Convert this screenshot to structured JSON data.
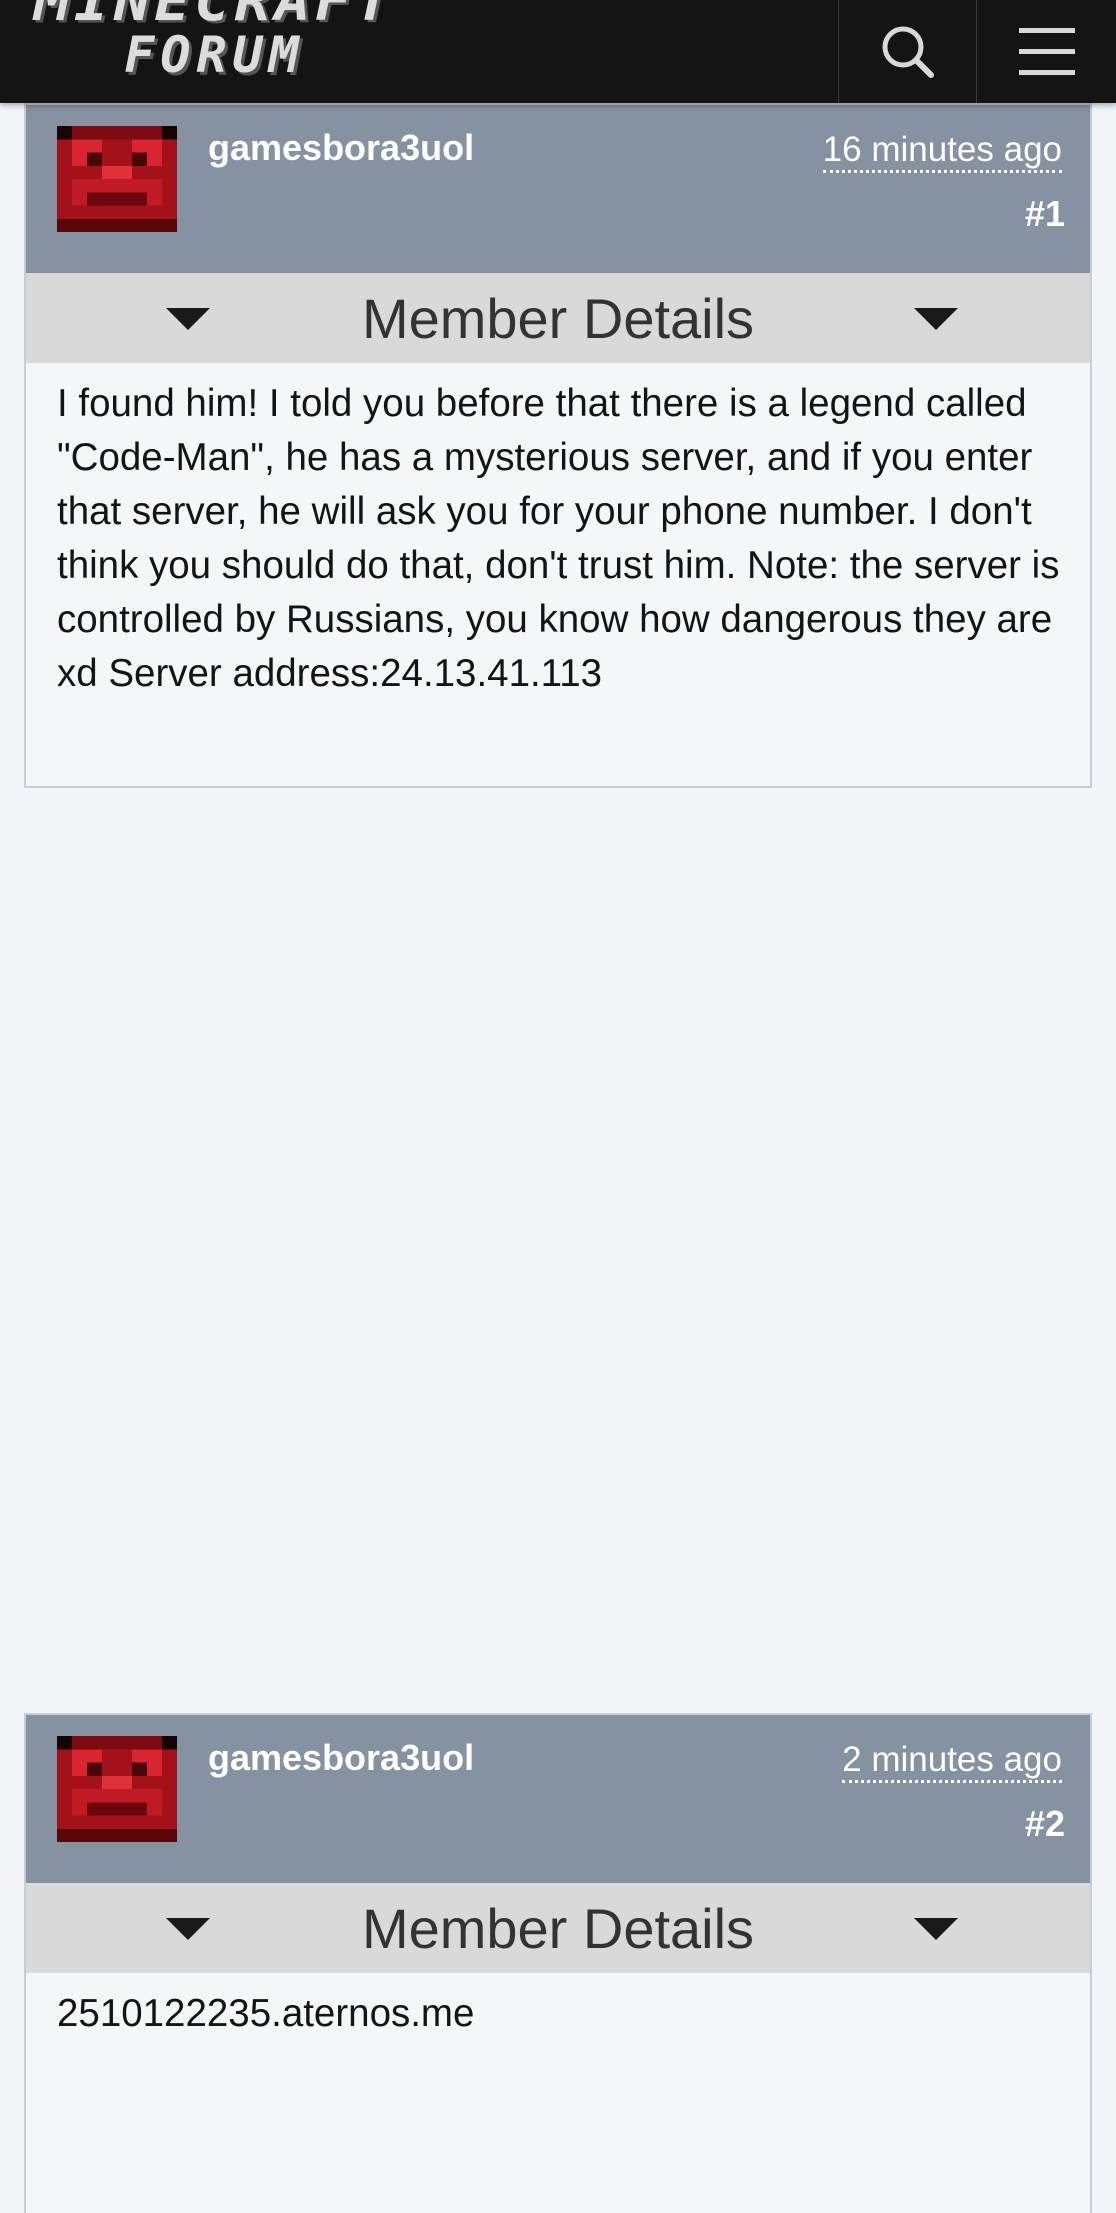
{
  "header": {
    "logo_line1": "MINECRAFT",
    "logo_line2": "FORUM",
    "search_icon": "search-icon",
    "menu_icon": "hamburger-menu-icon"
  },
  "posts": [
    {
      "username": "gamesbora3uol",
      "timestamp": "16 minutes ago",
      "number": "#1",
      "member_details_label": "Member Details",
      "body": "I found him! I told you before that there is a legend called \"Code-Man\", he has a mysterious server, and if you enter that server, he will ask you for your phone number. I don't think you should do that, don't trust him. Note: the server is controlled by Russians, you know how dangerous they are xd Server address:24.13.41.113"
    },
    {
      "username": "gamesbora3uol",
      "timestamp": "2 minutes ago",
      "number": "#2",
      "member_details_label": "Member Details",
      "body": "2510122235.aternos.me"
    }
  ],
  "colors": {
    "topbar": "#141414",
    "post_header": "#8691a1",
    "member_details_bar": "#d9d9d9",
    "page_background": "#f3f6f9",
    "avatar_red": "#b5141f"
  }
}
